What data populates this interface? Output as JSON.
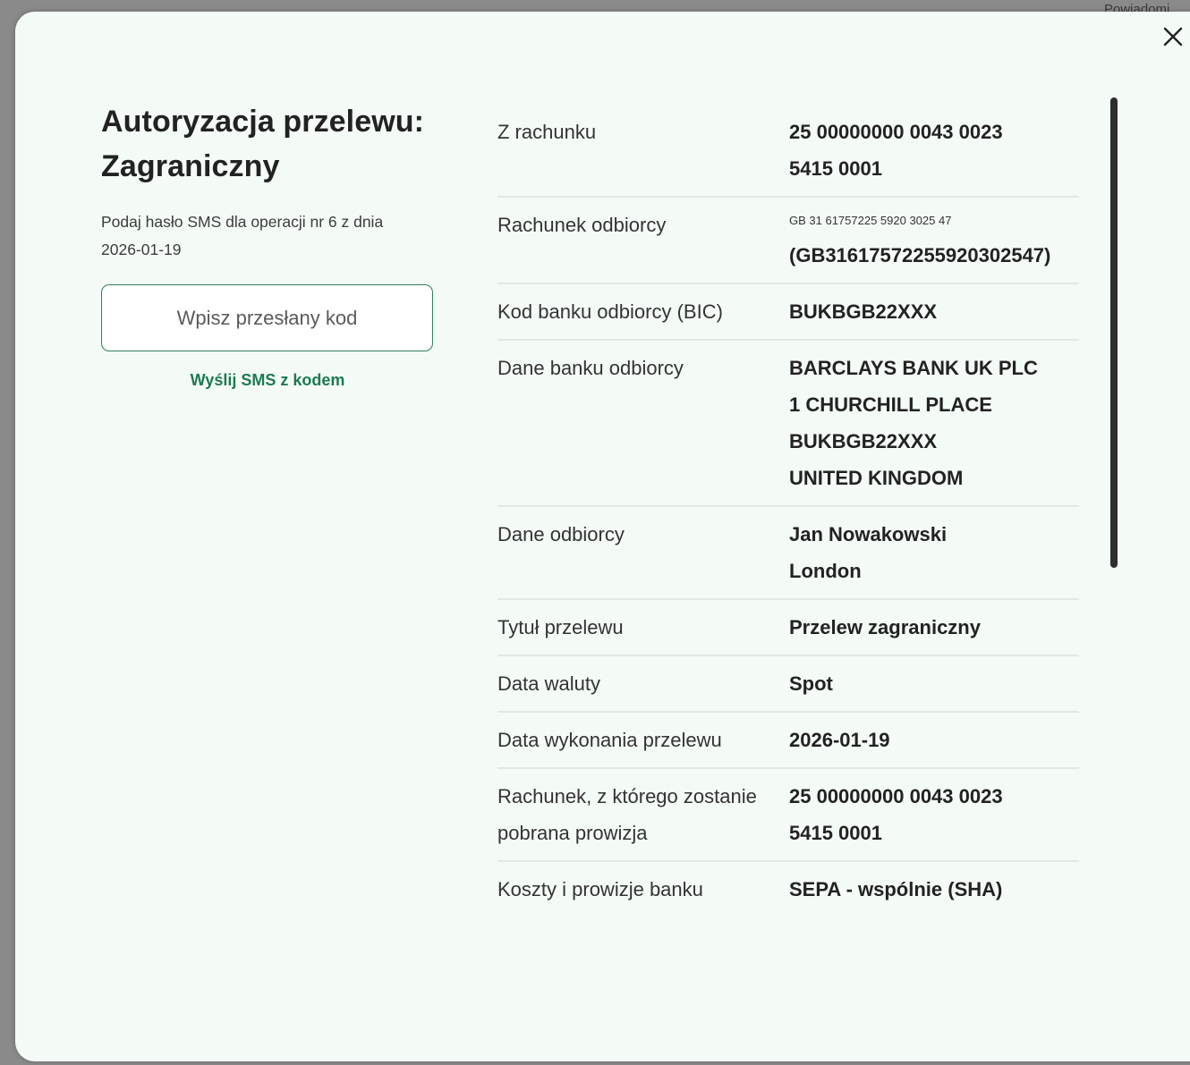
{
  "background": {
    "partial_text": "Powiadomi"
  },
  "modal": {
    "title": "Autoryzacja przelewu: Zagraniczny",
    "subtitle": "Podaj hasło SMS dla operacji nr 6 z dnia 2026-01-19",
    "code_input_placeholder": "Wpisz przesłany kod",
    "sms_link": "Wyślij SMS z kodem",
    "close_icon": "close-icon",
    "accent_color": "#1d7a52"
  },
  "details": {
    "from_account": {
      "label": "Z rachunku",
      "value": [
        "25 00000000 0043 0023",
        "5415 0001"
      ]
    },
    "recipient_account": {
      "label": "Rachunek odbiorcy",
      "value_small": "GB 31 61757225 5920 3025 47",
      "value": "(GB31617572255920302547)"
    },
    "bic": {
      "label": "Kod banku odbiorcy (BIC)",
      "value": "BUKBGB22XXX"
    },
    "bank_data": {
      "label": "Dane banku odbiorcy",
      "value": [
        "BARCLAYS BANK UK PLC",
        "1 CHURCHILL PLACE",
        "BUKBGB22XXX",
        "UNITED KINGDOM"
      ]
    },
    "recipient_data": {
      "label": "Dane odbiorcy",
      "value": [
        "Jan Nowakowski",
        "London"
      ]
    },
    "title": {
      "label": "Tytuł przelewu",
      "value": "Przelew zagraniczny"
    },
    "value_date": {
      "label": "Data waluty",
      "value": "Spot"
    },
    "execution_date": {
      "label": "Data wykonania przelewu",
      "value": "2026-01-19"
    },
    "fee_account": {
      "label": "Rachunek, z którego zostanie pobrana prowizja",
      "value": [
        "25 00000000 0043 0023",
        "5415 0001"
      ]
    },
    "costs": {
      "label": "Koszty i prowizje banku",
      "value": "SEPA - wspólnie (SHA)"
    }
  }
}
